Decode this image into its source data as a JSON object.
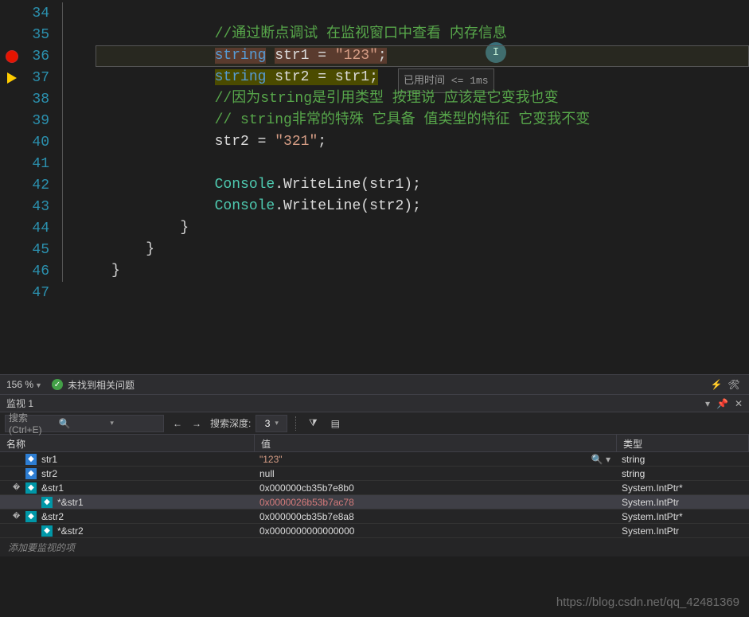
{
  "editor": {
    "lines": [
      {
        "num": 34,
        "segs": []
      },
      {
        "num": 35,
        "segs": [
          {
            "t": "//通过断点调试 在监视窗口中查看 内存信息",
            "c": "comment"
          }
        ]
      },
      {
        "num": 36,
        "segs": [
          {
            "t": "string",
            "c": "kw",
            "bg": "brown"
          },
          {
            "t": " ",
            "c": ""
          },
          {
            "t": "str1 = ",
            "c": "ident",
            "bg": "brown"
          },
          {
            "t": "\"123\"",
            "c": "str",
            "bg": "brown"
          },
          {
            "t": ";",
            "c": "",
            "bg": "brown"
          }
        ]
      },
      {
        "num": 37,
        "segs": [
          {
            "t": "string",
            "c": "kw",
            "bg": "yellow"
          },
          {
            "t": " ",
            "c": "",
            "bg": "yellow"
          },
          {
            "t": "str2 = str1;",
            "c": "ident",
            "bg": "yellow"
          }
        ]
      },
      {
        "num": 38,
        "segs": [
          {
            "t": "//因为string是引用类型 按理说 应该是它变我也变",
            "c": "comment"
          }
        ]
      },
      {
        "num": 39,
        "segs": [
          {
            "t": "// string非常的特殊 它具备 值类型的特征 它变我不变",
            "c": "comment"
          }
        ]
      },
      {
        "num": 40,
        "segs": [
          {
            "t": "str2 = ",
            "c": "ident"
          },
          {
            "t": "\"321\"",
            "c": "str"
          },
          {
            "t": ";",
            "c": ""
          }
        ]
      },
      {
        "num": 41,
        "segs": []
      },
      {
        "num": 42,
        "segs": [
          {
            "t": "Console",
            "c": "type"
          },
          {
            "t": ".WriteLine(str1);",
            "c": "ident"
          }
        ]
      },
      {
        "num": 43,
        "segs": [
          {
            "t": "Console",
            "c": "type"
          },
          {
            "t": ".WriteLine(str2);",
            "c": "ident"
          }
        ]
      },
      {
        "num": 44,
        "segs": [
          {
            "t": "}",
            "c": ""
          }
        ],
        "dedent": 1
      },
      {
        "num": 45,
        "segs": [
          {
            "t": "}",
            "c": ""
          }
        ],
        "dedent": 2
      },
      {
        "num": 46,
        "segs": [
          {
            "t": "}",
            "c": ""
          }
        ],
        "dedent": 3
      },
      {
        "num": 47,
        "segs": []
      }
    ],
    "breakpoint_line": 36,
    "current_line": 37,
    "elapsed_label": "已用时间",
    "elapsed_value": "<= 1ms"
  },
  "status": {
    "zoom": "156 %",
    "no_issues": "未找到相关问题"
  },
  "watch_panel": {
    "title": "监视 1",
    "search_placeholder": "搜索(Ctrl+E)",
    "depth_label": "搜索深度:",
    "depth_value": "3",
    "columns": {
      "name": "名称",
      "value": "值",
      "type": "类型"
    },
    "rows": [
      {
        "depth": 0,
        "exp": "",
        "icon": "cube-blue",
        "name": "str1",
        "value": "\"123\"",
        "vclass": "val-str",
        "type": "string",
        "loupe": true
      },
      {
        "depth": 0,
        "exp": "",
        "icon": "cube-blue",
        "name": "str2",
        "value": "null",
        "vclass": "",
        "type": "string"
      },
      {
        "depth": 0,
        "exp": "� ",
        "icon": "cube-teal",
        "name": "&str1",
        "value": "0x000000cb35b7e8b0",
        "vclass": "",
        "type": "System.IntPtr*"
      },
      {
        "depth": 1,
        "exp": "",
        "icon": "cube-teal",
        "name": "*&str1",
        "value": "0x0000026b53b7ac78",
        "vclass": "val-red",
        "type": "System.IntPtr",
        "sel": true
      },
      {
        "depth": 0,
        "exp": "� ",
        "icon": "cube-teal",
        "name": "&str2",
        "value": "0x000000cb35b7e8a8",
        "vclass": "",
        "type": "System.IntPtr*"
      },
      {
        "depth": 1,
        "exp": "",
        "icon": "cube-teal",
        "name": "*&str2",
        "value": "0x0000000000000000",
        "vclass": "",
        "type": "System.IntPtr"
      }
    ],
    "add_placeholder": "添加要监视的项"
  },
  "watermark": "https://blog.csdn.net/qq_42481369"
}
